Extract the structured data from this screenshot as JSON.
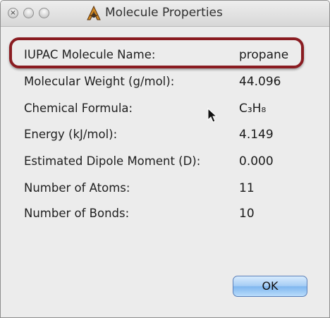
{
  "window": {
    "title": "Molecule Properties",
    "app_icon": "avogadro-icon",
    "traffic_lights": [
      "close",
      "minimize",
      "zoom"
    ]
  },
  "properties": [
    {
      "label": "IUPAC Molecule Name:",
      "value": "propane"
    },
    {
      "label": "Molecular Weight (g/mol):",
      "value": "44.096"
    },
    {
      "label": "Chemical Formula:",
      "value": "C₃H₈"
    },
    {
      "label": "Energy (kJ/mol):",
      "value": "4.149"
    },
    {
      "label": "Estimated Dipole Moment (D):",
      "value": "0.000"
    },
    {
      "label": "Number of Atoms:",
      "value": "11"
    },
    {
      "label": "Number of Bonds:",
      "value": "10"
    }
  ],
  "buttons": {
    "ok_label": "OK"
  },
  "colors": {
    "highlight": "#8a1c21",
    "ok_button": "#a6cdf5"
  }
}
